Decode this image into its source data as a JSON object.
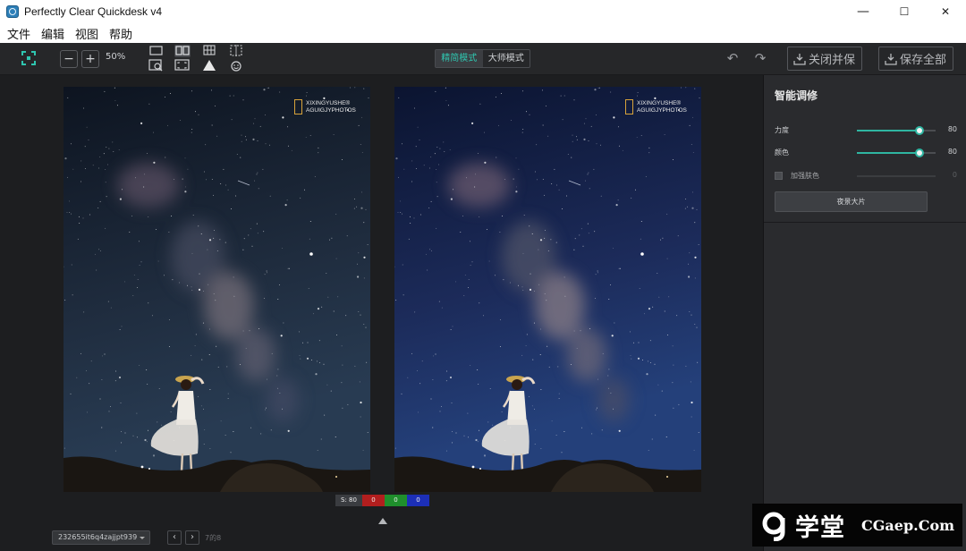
{
  "window": {
    "title": "Perfectly Clear Quickdesk v4",
    "minimize": "—",
    "maximize": "☐",
    "close": "✕"
  },
  "menu": [
    "文件",
    "编辑",
    "视图",
    "帮助"
  ],
  "toolbar": {
    "zoom_out": "−",
    "zoom_in": "+",
    "zoom_level": "50%",
    "modes": [
      "精简模式",
      "大师模式"
    ],
    "active_mode": "精简模式",
    "undo": "↶",
    "redo": "↷",
    "close_save": "关闭并保",
    "save_all": "保存全部"
  },
  "watermark": {
    "line1": "XIXINGYUSHE®",
    "line2": "AGUIGJYPHOTOS"
  },
  "rgb_readout": {
    "s": "S: 80",
    "r": "0",
    "g": "0",
    "b": "0"
  },
  "file_nav": {
    "filename": "232655it6q4zajjpt939",
    "prev": "‹",
    "next": "›",
    "page": "7的8"
  },
  "panel": {
    "title": "智能调修",
    "sliders": [
      {
        "label": "力度",
        "value": 80,
        "display": "80"
      },
      {
        "label": "颜色",
        "value": 80,
        "display": "80"
      }
    ],
    "skin": {
      "label": "加强肤色",
      "value": 0,
      "display": "0",
      "checked": false
    },
    "preset_button": "夜景大片"
  },
  "site": {
    "name": "学堂",
    "url": "CGaep.Com"
  },
  "colors": {
    "accent": "#2fb6a2",
    "active_mode": "#2fc6b0",
    "toolbar_bg": "#262729",
    "panel_bg": "#2a2b2e"
  }
}
